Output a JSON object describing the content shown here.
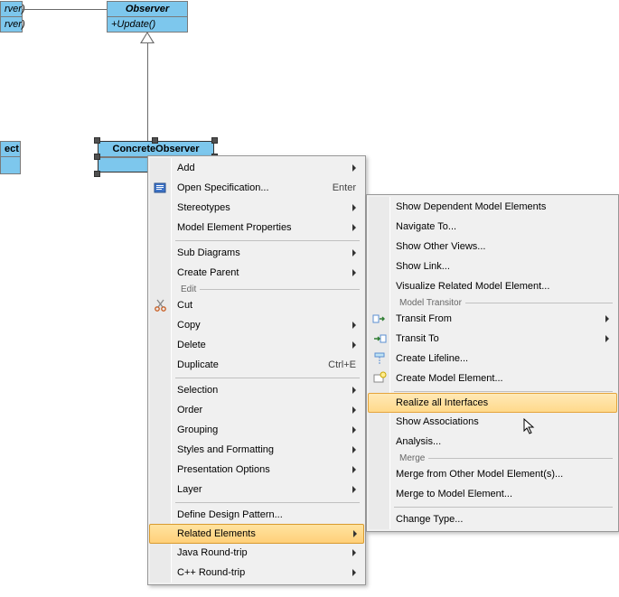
{
  "uml": {
    "partial_left": {
      "line1": "rver)",
      "line2": "rver)"
    },
    "partial_ect": {
      "title": "ect"
    },
    "observer": {
      "title": "Observer",
      "method": "+Update()"
    },
    "concrete": {
      "title": "ConcreteObserver"
    }
  },
  "menu1": {
    "add": "Add",
    "open_spec": "Open Specification...",
    "open_spec_key": "Enter",
    "stereotypes": "Stereotypes",
    "model_elem_props": "Model Element Properties",
    "sub_diagrams": "Sub Diagrams",
    "create_parent": "Create Parent",
    "edit_group": "Edit",
    "cut": "Cut",
    "copy": "Copy",
    "delete": "Delete",
    "duplicate": "Duplicate",
    "duplicate_key": "Ctrl+E",
    "selection": "Selection",
    "order": "Order",
    "grouping": "Grouping",
    "styles_fmt": "Styles and Formatting",
    "presentation": "Presentation Options",
    "layer": "Layer",
    "define_pattern": "Define Design Pattern...",
    "related_elements": "Related Elements",
    "java_rt": "Java Round-trip",
    "cpp_rt": "C++ Round-trip"
  },
  "menu2": {
    "show_dependent": "Show Dependent Model Elements",
    "navigate_to": "Navigate To...",
    "show_other_views": "Show Other Views...",
    "show_link": "Show Link...",
    "visualize_related": "Visualize Related Model Element...",
    "model_transitor_group": "Model Transitor",
    "transit_from": "Transit From",
    "transit_to": "Transit To",
    "create_lifeline": "Create Lifeline...",
    "create_model_element": "Create Model Element...",
    "realize_all": "Realize all Interfaces",
    "show_assoc": "Show Associations",
    "analysis": "Analysis...",
    "merge_group": "Merge",
    "merge_from": "Merge from Other Model Element(s)...",
    "merge_to": "Merge to Model Element...",
    "change_type": "Change Type..."
  }
}
